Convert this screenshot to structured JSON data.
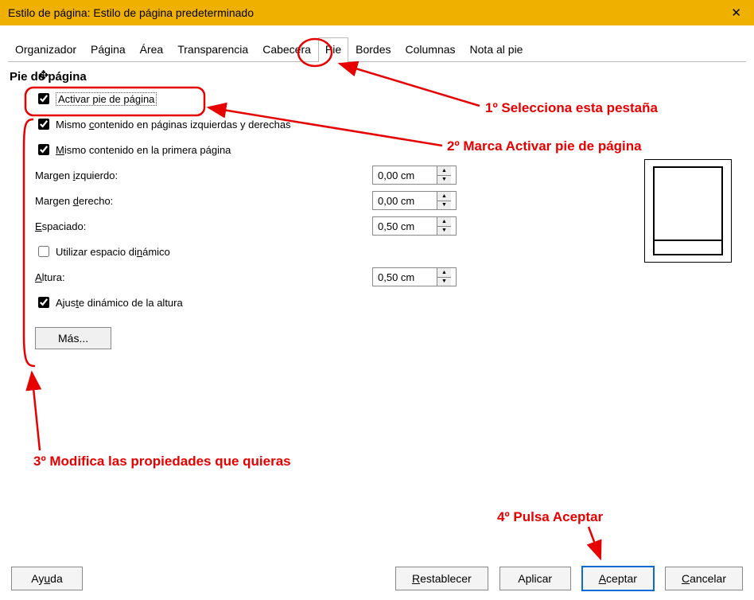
{
  "window": {
    "title": "Estilo de página: Estilo de página predeterminado"
  },
  "tabs": {
    "organizador": "Organizador",
    "pagina": "Página",
    "area": "Área",
    "transparencia": "Transparencia",
    "cabecera": "Cabecera",
    "pie": "Pie",
    "bordes": "Bordes",
    "columnas": "Columnas",
    "notaalpie": "Nota al pie"
  },
  "section": {
    "title": "Pie de página"
  },
  "checks": {
    "activar": "Activar pie de página",
    "mismo_izq_der_pre": "Mismo ",
    "mismo_izq_der_u": "c",
    "mismo_izq_der_post": "ontenido en páginas izquierdas y derechas",
    "mismo_primera_u": "M",
    "mismo_primera_post": "ismo contenido en la primera página",
    "espacio_din_pre": "Utilizar espacio di",
    "espacio_din_u": "n",
    "espacio_din_post": "ámico",
    "ajuste_pre": "Ajus",
    "ajuste_u": "t",
    "ajuste_post": "e dinámico de la altura"
  },
  "labels": {
    "margen_izq_pre": "Margen ",
    "margen_izq_u": "i",
    "margen_izq_post": "zquierdo:",
    "margen_der_pre": "Margen ",
    "margen_der_u": "d",
    "margen_der_post": "erecho:",
    "espaciado_u": "E",
    "espaciado_post": "spaciado:",
    "altura_u": "A",
    "altura_post": "ltura:"
  },
  "values": {
    "margen_izq": "0,00 cm",
    "margen_der": "0,00 cm",
    "espaciado": "0,50 cm",
    "altura": "0,50 cm"
  },
  "buttons": {
    "mas": "Más...",
    "ayuda_pre": "Ay",
    "ayuda_u": "u",
    "ayuda_post": "da",
    "restablecer_u": "R",
    "restablecer_post": "establecer",
    "aplicar": "Aplicar",
    "aceptar_u": "A",
    "aceptar_post": "ceptar",
    "cancelar_u": "C",
    "cancelar_post": "ancelar"
  },
  "annotations": {
    "a1": "1º Selecciona esta pestaña",
    "a2": "2º Marca Activar pie de página",
    "a3": "3º Modifica las propiedades que quieras",
    "a4": "4º Pulsa Aceptar"
  }
}
